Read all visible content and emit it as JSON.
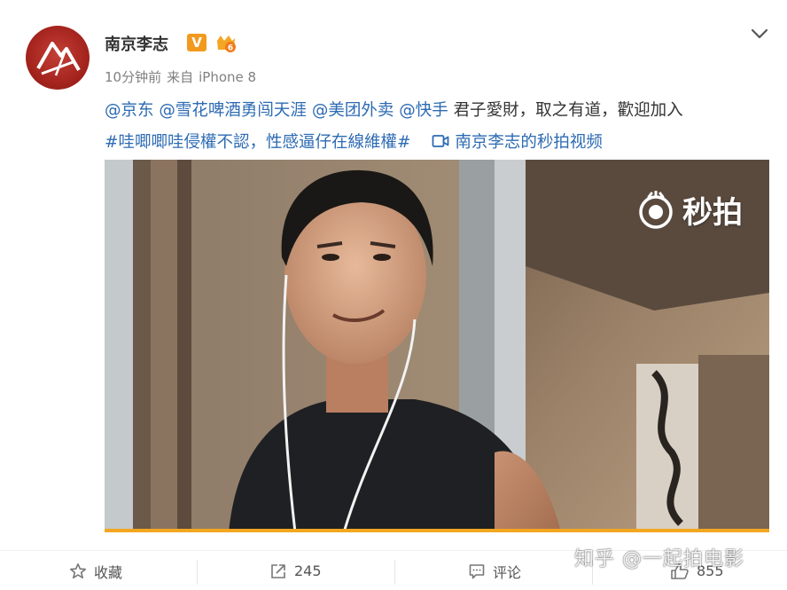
{
  "post": {
    "username": "南京李志",
    "vip_badge": "V",
    "time": "10分钟前",
    "source_prefix": "来自",
    "source_device": "iPhone 8",
    "mentions": [
      "@京东",
      "@雪花啤酒勇闯天涯",
      "@美团外卖",
      "@快手"
    ],
    "text_line1_tail": "君子愛財，取之有道，歡迎加入",
    "hashtag": "#哇唧唧哇侵權不認，性感逼仔在線維權#",
    "video_link_label": "南京李志的秒拍视频"
  },
  "video": {
    "overlay_logo_text": "秒拍",
    "progress": 1.0
  },
  "actions": {
    "favorite_label": "收藏",
    "share_count": "245",
    "comment_label": "评论",
    "like_count": "855"
  },
  "watermark": "知乎 @一起拍电影",
  "colors": {
    "link": "#2d6bb3",
    "vip": "#f29a1e",
    "progress": "#f2a720",
    "avatar": "#a5241e"
  },
  "icons": [
    "chevron-down-icon",
    "video-icon",
    "star-icon",
    "share-icon",
    "comment-icon",
    "thumb-up-icon",
    "miaopai-eye-icon"
  ]
}
